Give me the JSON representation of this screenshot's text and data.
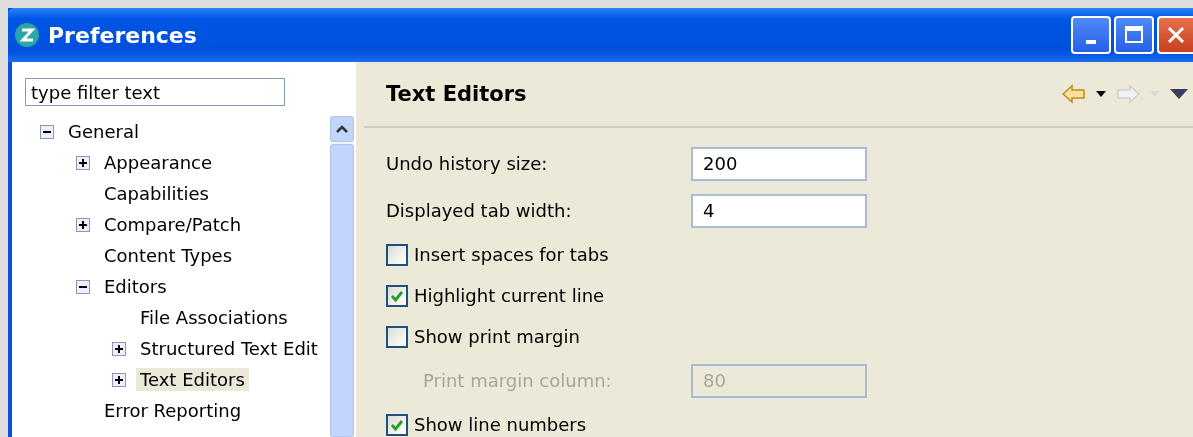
{
  "window": {
    "title": "Preferences"
  },
  "filter": {
    "placeholder": "type filter text"
  },
  "tree": [
    {
      "label": "General",
      "expanded": true,
      "selected": false,
      "children": [
        {
          "label": "Appearance",
          "expanded": false,
          "selected": false
        },
        {
          "label": "Capabilities",
          "selected": false
        },
        {
          "label": "Compare/Patch",
          "expanded": false,
          "selected": false
        },
        {
          "label": "Content Types",
          "selected": false
        },
        {
          "label": "Editors",
          "expanded": true,
          "selected": false,
          "children": [
            {
              "label": "File Associations",
              "selected": false
            },
            {
              "label": "Structured Text Edit",
              "expanded": false,
              "selected": false
            },
            {
              "label": "Text Editors",
              "expanded": false,
              "selected": true
            }
          ]
        },
        {
          "label": "Error Reporting",
          "selected": false
        }
      ]
    }
  ],
  "page": {
    "title": "Text Editors"
  },
  "settings": [
    {
      "kind": "field",
      "label": "Undo history size:",
      "value": "200",
      "disabled": false
    },
    {
      "kind": "field",
      "label": "Displayed tab width:",
      "value": "4",
      "disabled": false
    },
    {
      "kind": "checkbox",
      "label": "Insert spaces for tabs",
      "checked": false
    },
    {
      "kind": "checkbox",
      "label": "Highlight current line",
      "checked": true
    },
    {
      "kind": "checkbox",
      "label": "Show print margin",
      "checked": false
    },
    {
      "kind": "field",
      "label": "Print margin column:",
      "value": "80",
      "disabled": true
    },
    {
      "kind": "checkbox",
      "label": "Show line numbers",
      "checked": true
    }
  ]
}
